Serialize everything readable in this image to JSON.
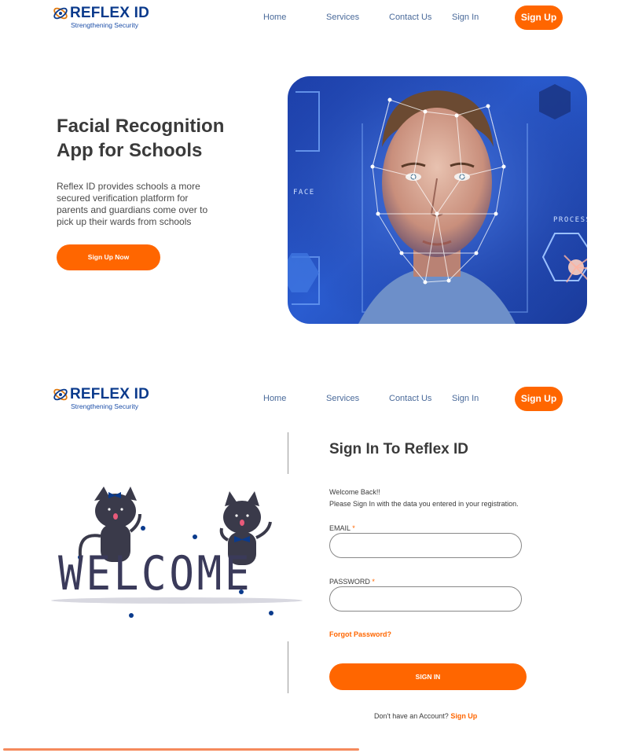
{
  "brand": {
    "name": "REFLEX ID",
    "tagline": "Strengthening Security",
    "accent_color": "#ff6600",
    "brand_color": "#0a3a8c"
  },
  "nav": {
    "home": "Home",
    "services": "Services",
    "contact": "Contact Us",
    "signin": "Sign In",
    "signup": "Sign Up"
  },
  "hero": {
    "title": "Facial Recognition App for Schools",
    "description": "Reflex ID provides schools a more secured verification platform for parents and guardians come over to pick up their wards from schools",
    "cta": "Sign Up Now",
    "image_labels": {
      "face": "FACE",
      "process": "PROCESS"
    }
  },
  "signin_page": {
    "illustration_text": "WELCOME",
    "title": "Sign In To Reflex ID",
    "welcome_line1": "Welcome Back!!",
    "welcome_line2": "Please Sign In with the data you entered in your registration.",
    "email_label": "EMAIL",
    "password_label": "PASSWORD",
    "required_mark": "*",
    "email_value": "",
    "password_value": "",
    "forgot": "Forgot Password?",
    "submit": "SIGN IN",
    "no_account": "Don't have an Account?",
    "signup_link": "Sign Up"
  },
  "icons": [
    "logo-mark-icon",
    "face-scan-icon",
    "hexagon-icon",
    "cat-icon"
  ]
}
